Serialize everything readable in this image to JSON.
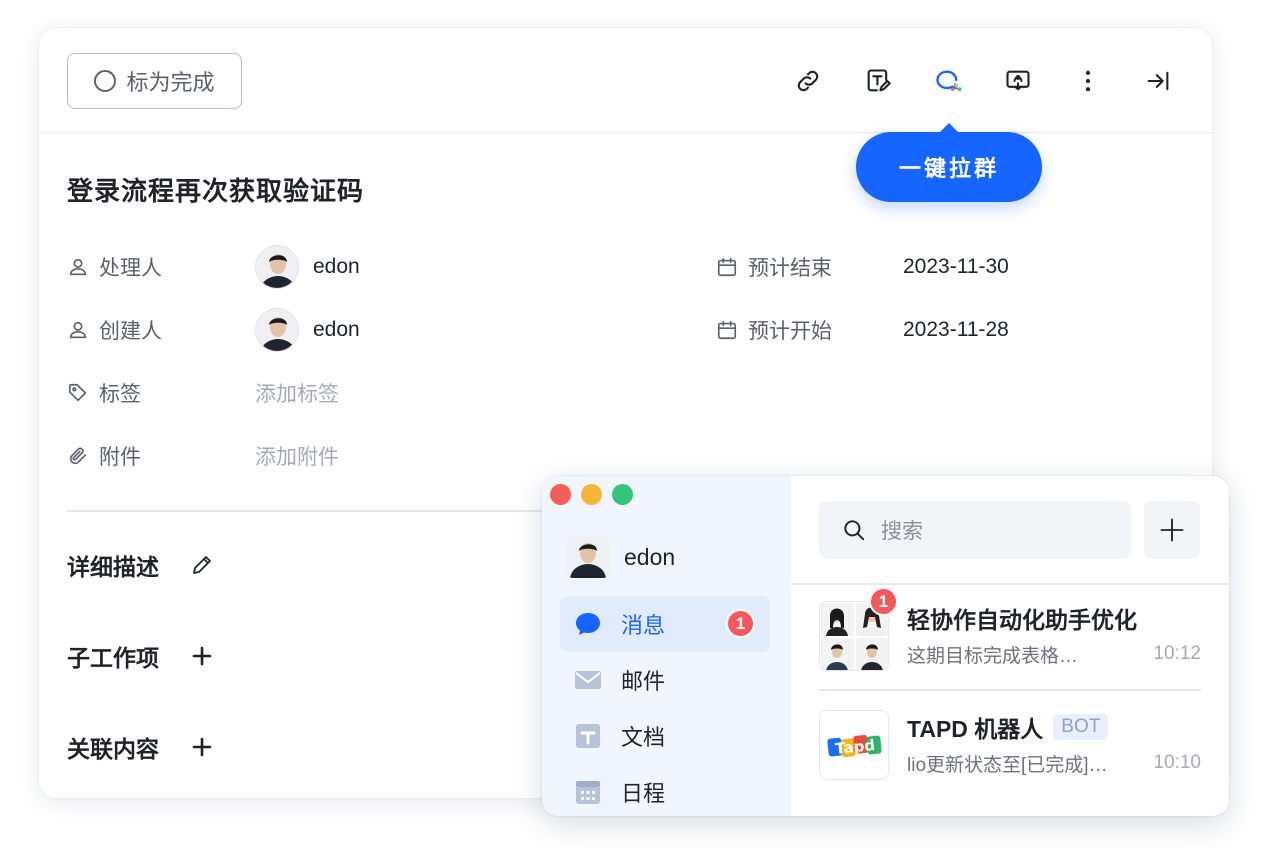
{
  "task": {
    "mark_done_label": "标为完成",
    "title": "登录流程再次获取验证码",
    "tooltip": "一键拉群",
    "fields": {
      "assignee": {
        "label": "处理人",
        "value": "edon"
      },
      "creator": {
        "label": "创建人",
        "value": "edon"
      },
      "tags": {
        "label": "标签",
        "placeholder": "添加标签"
      },
      "attachments": {
        "label": "附件",
        "placeholder": "添加附件"
      },
      "due_end": {
        "label": "预计结束",
        "value": "2023-11-30"
      },
      "due_start": {
        "label": "预计开始",
        "value": "2023-11-28"
      }
    },
    "sections": {
      "description": "详细描述",
      "subtasks": "子工作项",
      "related": "关联内容"
    },
    "toolbar_icons": [
      "link-icon",
      "edit-note-icon",
      "group-chat-icon",
      "share-screen-icon",
      "more-icon",
      "collapse-panel-icon"
    ]
  },
  "chat": {
    "user_name": "edon",
    "nav": [
      {
        "label": "消息",
        "icon": "message-icon",
        "badge": "1",
        "active": true
      },
      {
        "label": "邮件",
        "icon": "mail-icon"
      },
      {
        "label": "文档",
        "icon": "doc-icon"
      },
      {
        "label": "日程",
        "icon": "calendar-icon"
      }
    ],
    "search_placeholder": "搜索",
    "conversations": [
      {
        "name": "轻协作自动化助手优化",
        "preview": "这期目标完成表格…",
        "time": "10:12",
        "badge": "1"
      },
      {
        "name": "TAPD 机器人",
        "tag": "BOT",
        "preview": "lio更新状态至[已完成]…",
        "time": "10:10",
        "logo_text": "Tapd"
      }
    ]
  },
  "colors": {
    "accent": "#1765ff",
    "badge": "#f4575c",
    "traffic_red": "#f25f58",
    "traffic_yellow": "#f6b43b",
    "traffic_green": "#33c67a"
  }
}
